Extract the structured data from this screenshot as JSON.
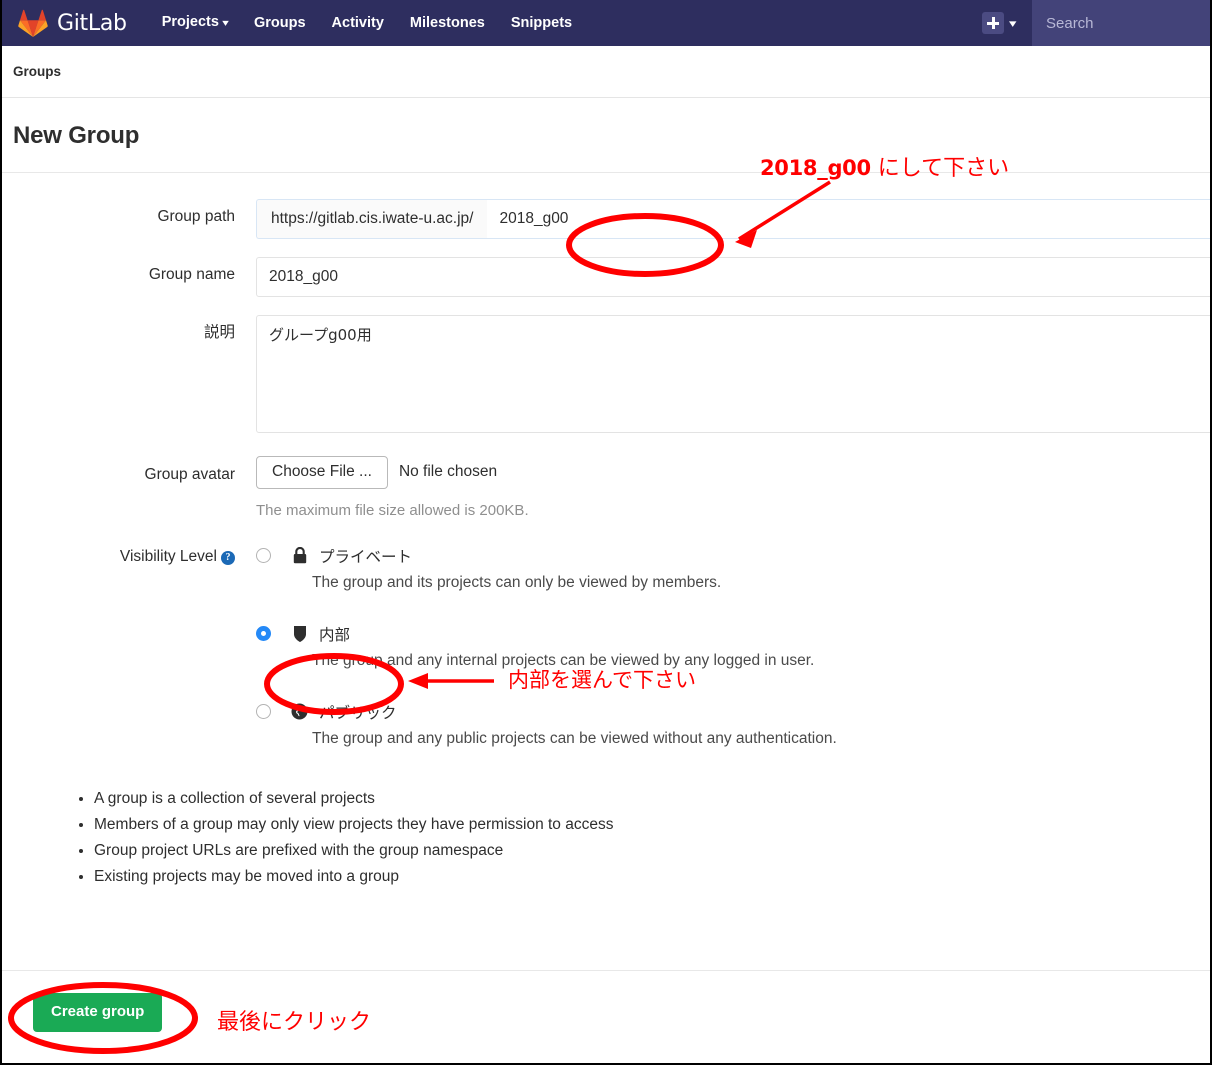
{
  "navbar": {
    "brand": "GitLab",
    "logo_icon": "gitlab-tanuki-icon",
    "links": [
      {
        "label": "Projects",
        "has_caret": true
      },
      {
        "label": "Groups",
        "has_caret": false
      },
      {
        "label": "Activity",
        "has_caret": false
      },
      {
        "label": "Milestones",
        "has_caret": false
      },
      {
        "label": "Snippets",
        "has_caret": false
      }
    ],
    "plus_icon": "plus-square-icon",
    "plus_caret_icon": "chevron-down-icon",
    "search_placeholder": "Search",
    "background_color": "#2e2e5f",
    "search_background_color": "#434379"
  },
  "breadcrumb": {
    "items": [
      "Groups"
    ]
  },
  "header": {
    "title": "New Group"
  },
  "form": {
    "group_path": {
      "label": "Group path",
      "prefix": "https://gitlab.cis.iwate-u.ac.jp/",
      "value": "2018_g00",
      "placeholder": ""
    },
    "group_name": {
      "label": "Group name",
      "value": "2018_g00",
      "placeholder": ""
    },
    "description": {
      "label": "説明",
      "value": "グループg00用",
      "placeholder": ""
    },
    "group_avatar": {
      "label": "Group avatar",
      "choose_file_label": "Choose File ...",
      "no_file_label": "No file chosen",
      "help_text": "The maximum file size allowed is 200KB."
    },
    "visibility": {
      "label": "Visibility Level",
      "help_icon": "question-mark-icon",
      "options": [
        {
          "icon": "lock-icon",
          "name": "プライベート",
          "description": "The group and its projects can only be viewed by members.",
          "selected": false
        },
        {
          "icon": "shield-icon",
          "name": "内部",
          "description": "The group and any internal projects can be viewed by any logged in user.",
          "selected": true
        },
        {
          "icon": "globe-icon",
          "name": "パブリック",
          "description": "The group and any public projects can be viewed without any authentication.",
          "selected": false
        }
      ]
    },
    "info_bullets": [
      "A group is a collection of several projects",
      "Members of a group may only view projects they have permission to access",
      "Group project URLs are prefixed with the group namespace",
      "Existing projects may be moved into a group"
    ]
  },
  "footer": {
    "create_button_label": "Create group",
    "create_button_color": "#1aaa55"
  },
  "annotations": {
    "color": "#ff0000",
    "path_note_code": "2018_g00",
    "path_note_text": " にして下さい",
    "internal_note": "内部を選んで下さい",
    "final_note": "最後にクリック"
  }
}
